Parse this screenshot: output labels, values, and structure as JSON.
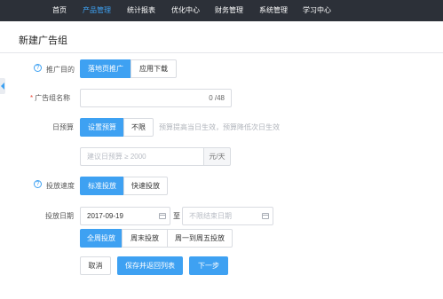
{
  "nav": {
    "items": [
      "首页",
      "产品管理",
      "统计报表",
      "优化中心",
      "财务管理",
      "系统管理",
      "学习中心"
    ],
    "active_index": 1,
    "accent_color": "#3ea1f2"
  },
  "page": {
    "title": "新建广告组"
  },
  "promo_goal": {
    "label": "推广目的",
    "options": [
      "落地页推广",
      "应用下载"
    ],
    "selected_index": 0
  },
  "ad_group_name": {
    "label": "广告组名称",
    "value": "",
    "counter": "0 /48"
  },
  "daily_budget": {
    "label": "日预算",
    "options": [
      "设置预算",
      "不限"
    ],
    "selected_index": 0,
    "hint": "预算提高当日生效，预算降低次日生效",
    "input_placeholder": "建议日预算 ≥ 2000",
    "unit": "元/天"
  },
  "delivery_speed": {
    "label": "投放速度",
    "options": [
      "标准投放",
      "快速投放"
    ],
    "selected_index": 0
  },
  "delivery_date": {
    "label": "投放日期",
    "start": "2017-09-19",
    "to": "至",
    "end_placeholder": "不限结束日期",
    "period_options": [
      "全周投放",
      "周末投放",
      "周一到周五投放"
    ],
    "selected_index": 0
  },
  "actions": {
    "cancel": "取消",
    "save_return": "保存并返回列表",
    "next": "下一步"
  },
  "icons": {
    "help": "help-circle-icon",
    "calendar": "calendar-icon",
    "collapse": "collapse-left-icon"
  }
}
